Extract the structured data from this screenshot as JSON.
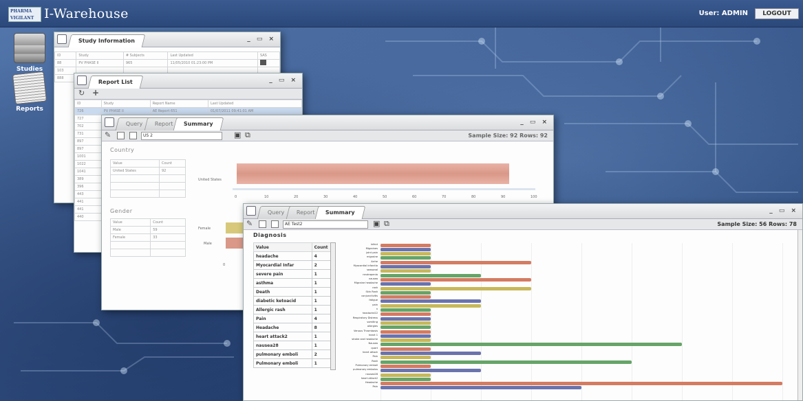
{
  "app": {
    "logo": "PHARMA VIGILANT",
    "name": "I-Warehouse",
    "user": "User: ADMIN",
    "logout": "LOGOUT"
  },
  "nav": [
    {
      "label": "Studies",
      "icon": "studies-icon"
    },
    {
      "label": "Reports",
      "icon": "reports-icon"
    }
  ],
  "study_window": {
    "title": "Study Information",
    "controls": "_ ▭ ×",
    "columns": [
      "ID",
      "Study",
      "# Subjects",
      "Last Updated",
      "SAS"
    ],
    "rows": [
      [
        "88",
        "PV PHASE II",
        "965",
        "11/05/2010 01:23:00 PM",
        ""
      ],
      [
        "103",
        "",
        "",
        "",
        ""
      ],
      [
        "888",
        "",
        "",
        "",
        ""
      ]
    ]
  },
  "report_window": {
    "title": "Report List",
    "controls": "_ ▭ ×",
    "columns": [
      "ID",
      "Study",
      "Report Name",
      "Last Updated"
    ],
    "rows": [
      [
        "726",
        "PV PHASE II",
        "AE Report 651",
        "01/07/2011 09:41:01 AM"
      ],
      [
        "727",
        "",
        "",
        ""
      ],
      [
        "702",
        "",
        "",
        ""
      ],
      [
        "731",
        "",
        "",
        ""
      ],
      [
        "897",
        "",
        "",
        ""
      ],
      [
        "897",
        "",
        "",
        ""
      ],
      [
        "1001",
        "",
        "",
        ""
      ],
      [
        "1022",
        "",
        "",
        ""
      ],
      [
        "1041",
        "",
        "",
        ""
      ],
      [
        "389",
        "",
        "",
        ""
      ],
      [
        "396",
        "",
        "",
        ""
      ],
      [
        "443",
        "",
        "",
        ""
      ],
      [
        "441",
        "",
        "",
        ""
      ],
      [
        "441",
        "",
        "",
        ""
      ],
      [
        "440",
        "",
        "",
        ""
      ]
    ]
  },
  "summary1": {
    "tabs": [
      "Query",
      "Report",
      "Summary"
    ],
    "controls": "_ ▭ ×",
    "input": "US 2",
    "sample": "Sample Size: 92   Rows: 92",
    "country": {
      "title": "Country",
      "columns": [
        "Value",
        "Count"
      ],
      "rows": [
        [
          "United States",
          "92"
        ]
      ],
      "bar_label": "United States",
      "value": 92
    },
    "axis_ticks": [
      "0",
      "10",
      "20",
      "30",
      "40",
      "50",
      "60",
      "70",
      "80",
      "90",
      "100"
    ],
    "gender": {
      "title": "Gender",
      "columns": [
        "Value",
        "Count"
      ],
      "rows": [
        [
          "Male",
          "59"
        ],
        [
          "Female",
          "33"
        ]
      ],
      "labels": [
        "Female",
        "Male"
      ],
      "axis0": "0"
    }
  },
  "summary2": {
    "tabs": [
      "Query",
      "Report",
      "Summary"
    ],
    "controls": "_ ▭ ×",
    "input": "AE Test2",
    "sample": "Sample Size: 56   Rows: 78",
    "diagnosis": {
      "title": "Diagnosis",
      "columns": [
        "Value",
        "Count"
      ],
      "rows": [
        [
          "headache",
          "4"
        ],
        [
          "Myocardial Infar",
          "2"
        ],
        [
          "severe pain",
          "1"
        ],
        [
          "asthma",
          "1"
        ],
        [
          "Death",
          "1"
        ],
        [
          "diabetic ketoacid",
          "1"
        ],
        [
          "Allergic rash",
          "1"
        ],
        [
          "Pain",
          "4"
        ],
        [
          "Headache",
          "8"
        ],
        [
          "heart attack2",
          "1"
        ],
        [
          "nausea28",
          "1"
        ],
        [
          "pulmonary emboli",
          "2"
        ],
        [
          "Pulmonary emboli",
          "1"
        ]
      ]
    }
  },
  "chart_data": {
    "type": "bar",
    "orientation": "horizontal",
    "categories": [
      "infect",
      "Migraines",
      "joint pain",
      "migraine",
      "Arrhe",
      "Myocardial infarctio",
      "seasonal",
      "neutropenia",
      "nausea",
      "Migraine headache",
      "rash",
      "Skin Rash",
      "conjunctivitis",
      "fatigue",
      "pain",
      "n",
      "headache22",
      "Respiratory Distress",
      "vomiting",
      "allergies",
      "Venous Thrombosis",
      "heart 1",
      "stroke and headache",
      "Nausea",
      "quart",
      "heart attack",
      "Pain",
      "Rash",
      "Pulmonary emboli",
      "pulmonary embolus",
      "nausea28",
      "heart attack2",
      "Headache",
      "Pain"
    ],
    "values": [
      1,
      1,
      1,
      1,
      3,
      1,
      1,
      2,
      3,
      1,
      3,
      1,
      1,
      2,
      2,
      1,
      1,
      1,
      1,
      1,
      1,
      1,
      1,
      6,
      1,
      2,
      1,
      5,
      1,
      2,
      1,
      1,
      8,
      4
    ],
    "colors": [
      "#d47b62",
      "#6a73ad",
      "#c7b85a",
      "#66a468"
    ]
  }
}
